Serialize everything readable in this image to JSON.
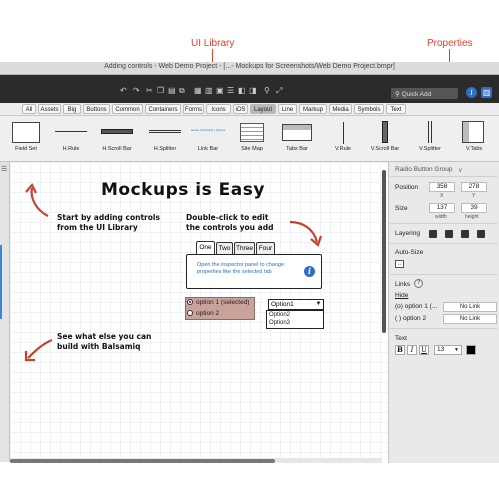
{
  "annotations": {
    "ui_library": "UI Library",
    "properties": "Properties"
  },
  "window": {
    "title": "Adding controls - Web Demo Project - [...- Mockups for Screenshots/Web Demo Project.bmpr]"
  },
  "toolbar": {
    "quick_add_placeholder": "Quick Add"
  },
  "filter_tabs": [
    {
      "label": "All",
      "selected": false
    },
    {
      "label": "Assets",
      "selected": false
    },
    {
      "label": "Big",
      "selected": false
    },
    {
      "label": "Buttons",
      "selected": false
    },
    {
      "label": "Common",
      "selected": false
    },
    {
      "label": "Containers",
      "selected": false
    },
    {
      "label": "Forms",
      "selected": false
    },
    {
      "label": "Icons",
      "selected": false
    },
    {
      "label": "iOS",
      "selected": false
    },
    {
      "label": "Layout",
      "selected": true
    },
    {
      "label": "Line",
      "selected": false
    },
    {
      "label": "Markup",
      "selected": false
    },
    {
      "label": "Media",
      "selected": false
    },
    {
      "label": "Symbols",
      "selected": false
    },
    {
      "label": "Text",
      "selected": false
    }
  ],
  "library": [
    {
      "label": "Field Set",
      "icon": "field-set-icon"
    },
    {
      "label": "H.Rule",
      "icon": "h-rule-icon"
    },
    {
      "label": "H.Scroll Bar",
      "icon": "h-scroll-bar-icon"
    },
    {
      "label": "H.Splitter",
      "icon": "h-splitter-icon"
    },
    {
      "label": "Link Bar",
      "icon": "link-bar-icon",
      "preview": "Home | Products | Xtreme | Cool Stuff"
    },
    {
      "label": "Site Map",
      "icon": "site-map-icon"
    },
    {
      "label": "Tabs Bar",
      "icon": "tabs-bar-icon"
    },
    {
      "label": "V.Rule",
      "icon": "v-rule-icon"
    },
    {
      "label": "V.Scroll Bar",
      "icon": "v-scroll-bar-icon"
    },
    {
      "label": "V.Splitter",
      "icon": "v-splitter-icon"
    },
    {
      "label": "V.Tabs",
      "icon": "v-tabs-icon"
    }
  ],
  "canvas": {
    "title": "Mockups is Easy",
    "note_library_1": "Start by adding controls",
    "note_library_2": "from the UI Library",
    "note_edit_1": "Double-click to edit",
    "note_edit_2": "the controls you add",
    "note_balsamiq_1": "See what else you can",
    "note_balsamiq_2": "build with Balsamiq",
    "tabs": [
      "One",
      "Two",
      "Three",
      "Four"
    ],
    "tab_content": "Open the inspector panel to change properties like the selected tab",
    "radio_options": [
      {
        "label": "option 1 (selected)",
        "checked": true
      },
      {
        "label": "option 2",
        "checked": false
      }
    ],
    "combo_value": "Option1",
    "combo_options": [
      "Option2",
      "Option3"
    ]
  },
  "inspector": {
    "control_name": "Radio Button Group",
    "position_label": "Position",
    "position_x": "358",
    "position_y": "278",
    "x_label": "X",
    "y_label": "Y",
    "size_label": "Size",
    "size_width": "137",
    "size_height": "39",
    "width_label": "width",
    "height_label": "height",
    "layering_label": "Layering",
    "autosize_label": "Auto-Size",
    "links_label": "Links",
    "links_help": "?",
    "hide_label": "Hide",
    "link_rows": [
      {
        "label": "(o) option 1 (...",
        "value": "No Link"
      },
      {
        "label": "( ) option 2",
        "value": "No Link"
      }
    ],
    "text_label": "Text",
    "bold": "B",
    "italic": "I",
    "underline": "U",
    "font_size": "13",
    "text_color": "#000000"
  },
  "colors": {
    "accent_red": "#d9412b",
    "toolbar_bg": "#2b2b2b",
    "link_blue": "#2c6fc4",
    "selection_fill": "#c9a39a"
  }
}
